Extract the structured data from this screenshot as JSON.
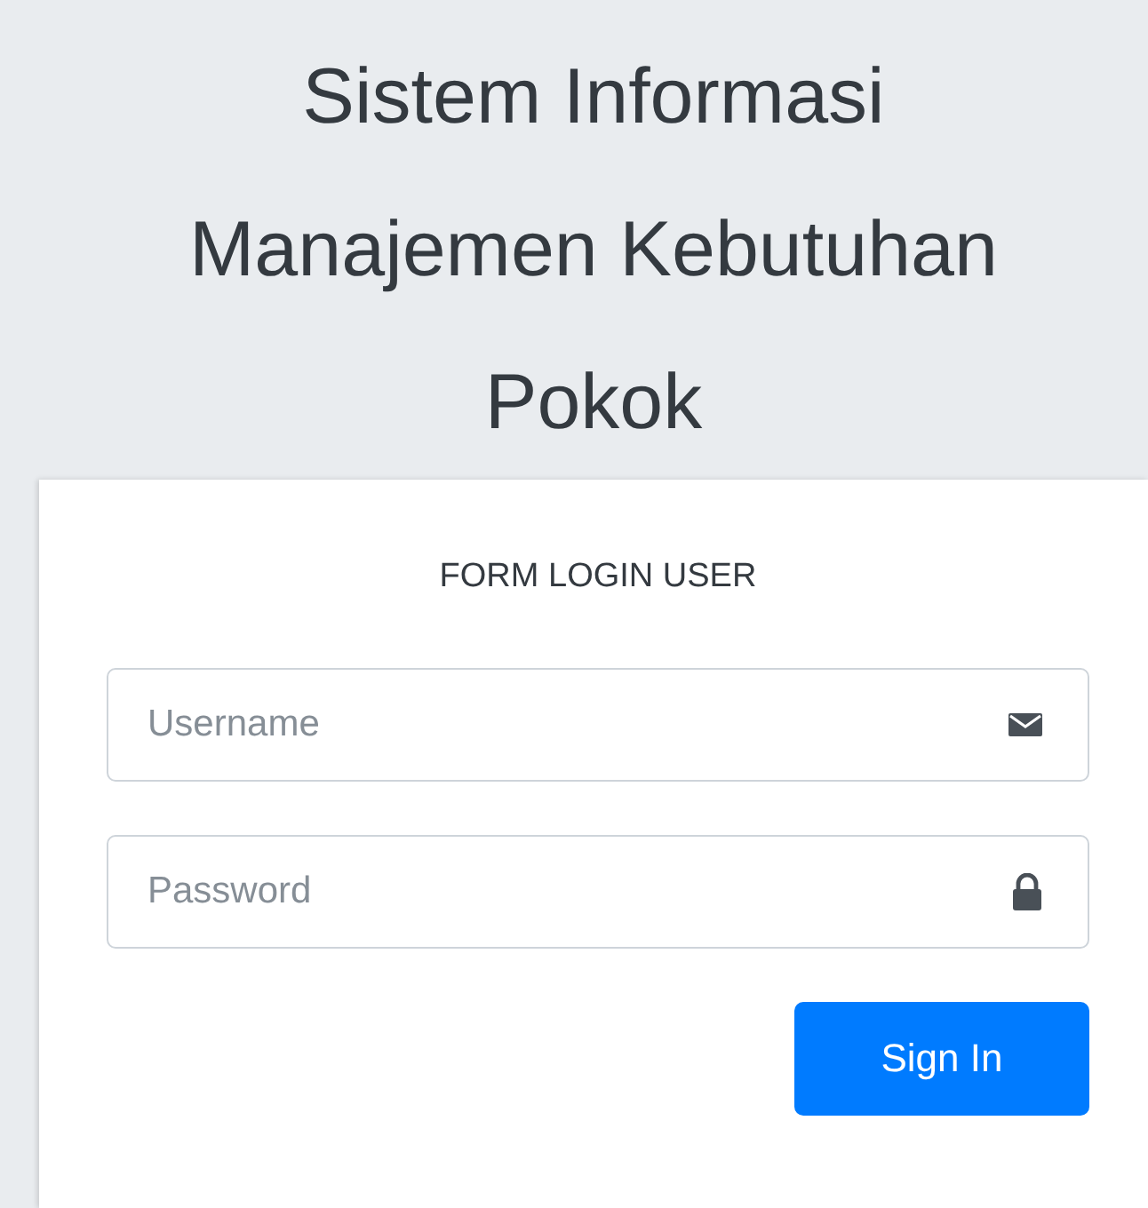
{
  "header": {
    "title_lines": [
      "Sistem Informasi",
      "Manajemen Kebutuhan",
      "Pokok"
    ]
  },
  "form": {
    "heading": "FORM LOGIN USER",
    "fields": [
      {
        "kind": "email",
        "placeholder": "Username"
      },
      {
        "kind": "password",
        "placeholder": "Password"
      }
    ],
    "submit": "Sign In"
  }
}
